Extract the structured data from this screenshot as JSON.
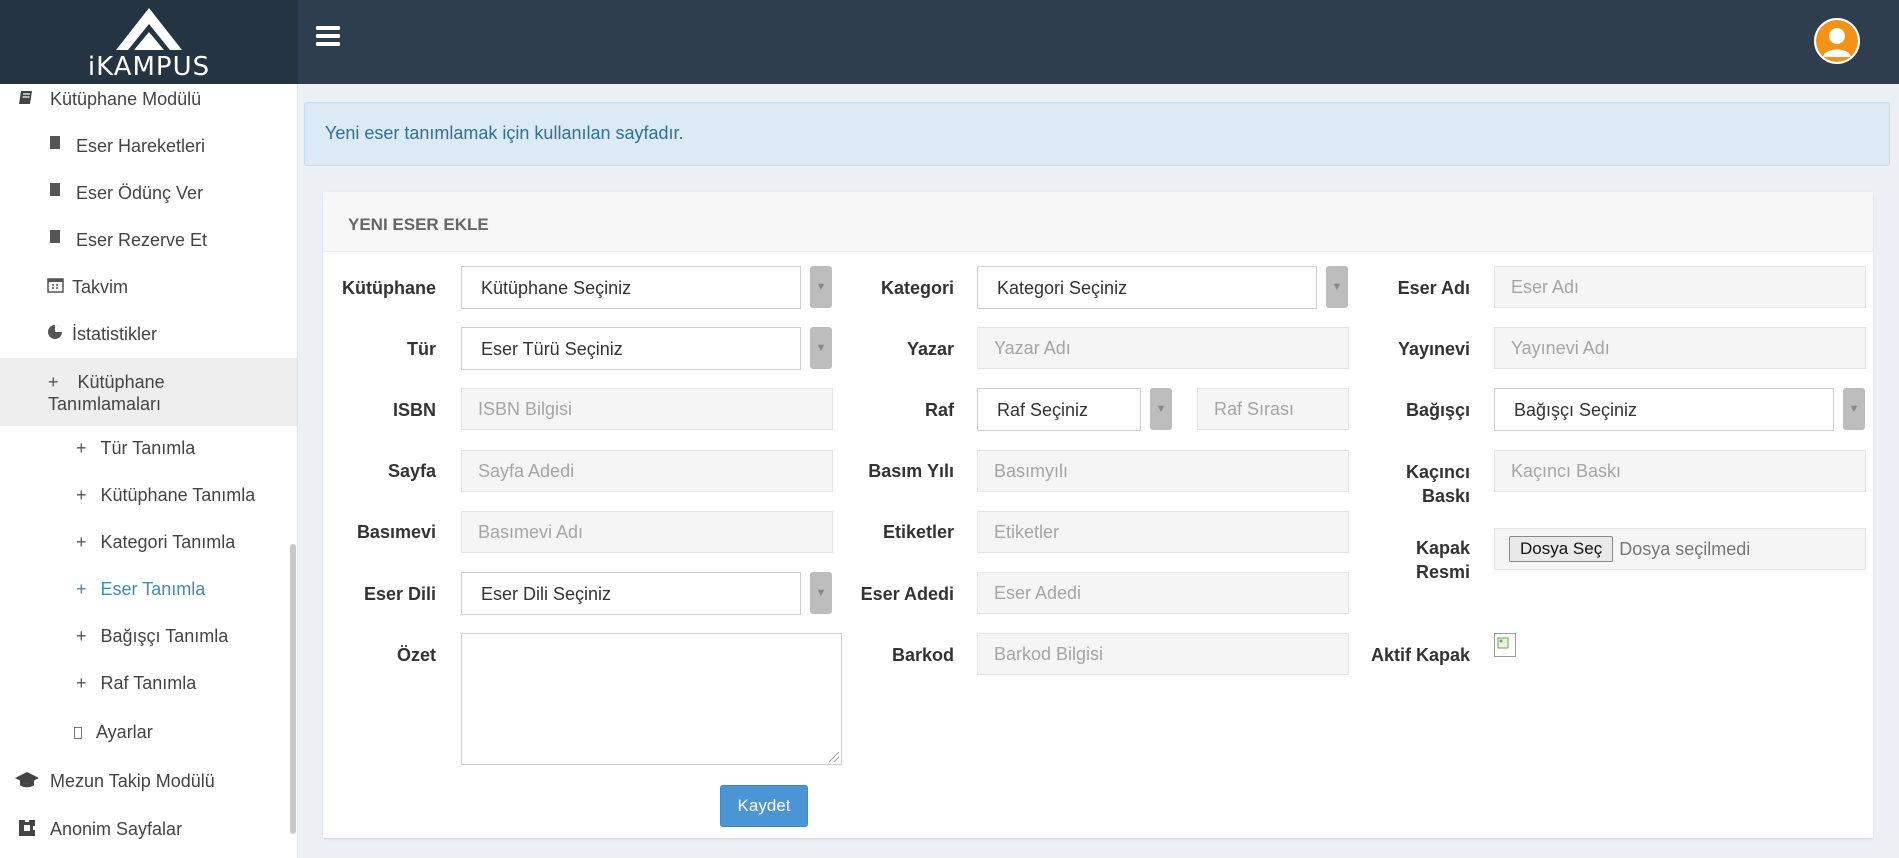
{
  "brand": {
    "logo_text": "iKAMPUS"
  },
  "sidebar": {
    "module": "Kütüphane Modülü",
    "items": [
      {
        "label": "Eser Hareketleri"
      },
      {
        "label": "Eser Ödünç Ver"
      },
      {
        "label": "Eser Rezerve Et"
      },
      {
        "label": "Takvim"
      },
      {
        "label": "İstatistikler"
      }
    ],
    "group": {
      "label_line1": "Kütüphane",
      "label_line2": "Tanımlamaları"
    },
    "sub_items": [
      {
        "label": "Tür Tanımla"
      },
      {
        "label": "Kütüphane Tanımla"
      },
      {
        "label": "Kategori Tanımla"
      },
      {
        "label": "Eser Tanımla",
        "active": true
      },
      {
        "label": "Bağışçı Tanımla"
      },
      {
        "label": "Raf Tanımla"
      }
    ],
    "settings": "Ayarlar",
    "mezun": "Mezun Takip Modülü",
    "anonim": "Anonim Sayfalar"
  },
  "alert": {
    "text": "Yeni eser tanımlamak için kullanılan sayfadır."
  },
  "panel": {
    "title": "YENI ESER EKLE"
  },
  "form": {
    "kutuphane": {
      "label": "Kütüphane",
      "value": "Kütüphane Seçiniz"
    },
    "tur": {
      "label": "Tür",
      "value": "Eser Türü Seçiniz"
    },
    "isbn": {
      "label": "ISBN",
      "placeholder": "ISBN Bilgisi"
    },
    "sayfa": {
      "label": "Sayfa",
      "placeholder": "Sayfa Adedi"
    },
    "basimevi": {
      "label": "Basımevi",
      "placeholder": "Basımevi Adı"
    },
    "eser_dili": {
      "label": "Eser Dili",
      "value": "Eser Dili Seçiniz"
    },
    "ozet": {
      "label": "Özet"
    },
    "kategori": {
      "label": "Kategori",
      "value": "Kategori Seçiniz"
    },
    "yazar": {
      "label": "Yazar",
      "placeholder": "Yazar Adı"
    },
    "raf": {
      "label": "Raf",
      "value": "Raf Seçiniz",
      "sira_placeholder": "Raf Sırası"
    },
    "basim_yili": {
      "label": "Basım Yılı",
      "placeholder": "Basımyılı"
    },
    "etiketler": {
      "label": "Etiketler",
      "placeholder": "Etiketler"
    },
    "eser_adedi": {
      "label": "Eser Adedi",
      "placeholder": "Eser Adedi"
    },
    "barkod": {
      "label": "Barkod",
      "placeholder": "Barkod Bilgisi"
    },
    "eser_adi": {
      "label": "Eser Adı",
      "placeholder": "Eser Adı"
    },
    "yayinevi": {
      "label": "Yayınevi",
      "placeholder": "Yayınevi Adı"
    },
    "bagisci": {
      "label": "Bağışçı",
      "value": "Bağışçı Seçiniz"
    },
    "kacinci_baski": {
      "label_line1": "Kaçıncı",
      "label_line2": "Baskı",
      "placeholder": "Kaçıncı Baskı"
    },
    "kapak_resmi": {
      "label_line1": "Kapak",
      "label_line2": "Resmi",
      "button": "Dosya Seç",
      "status": "Dosya seçilmedi"
    },
    "aktif_kapak": {
      "label": "Aktif Kapak"
    },
    "submit": "Kaydet"
  },
  "colors": {
    "topbar": "#2e3e4e",
    "accent": "#3c8dbc",
    "button": "#4b94d5",
    "alert_bg": "#dceaf7"
  }
}
